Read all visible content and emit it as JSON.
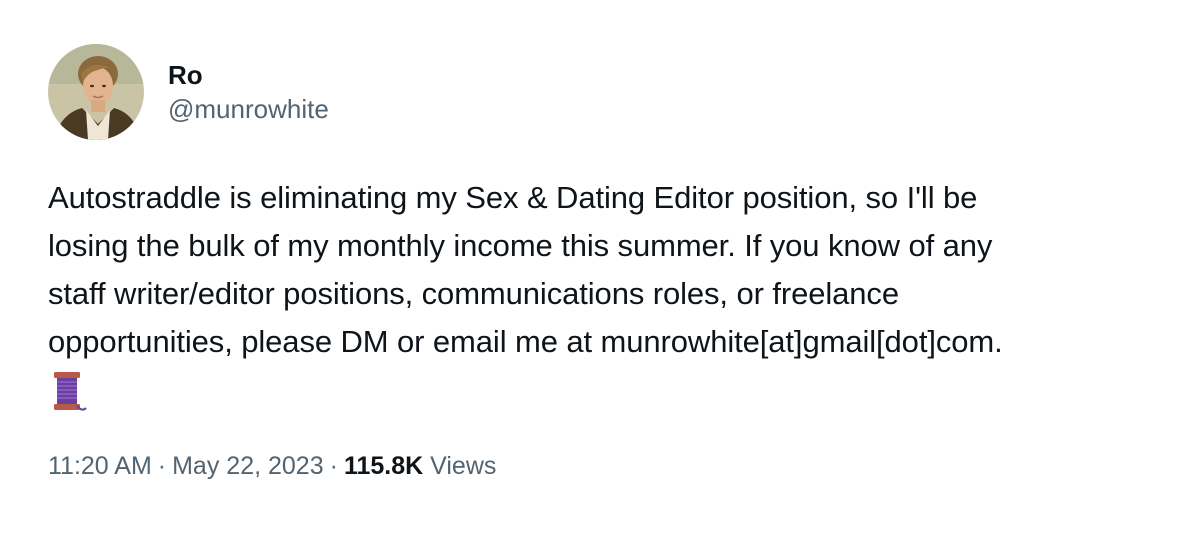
{
  "author": {
    "display_name": "Ro",
    "handle": "@munrowhite"
  },
  "tweet": {
    "lines": [
      "Autostraddle is eliminating my Sex & Dating Editor position, so I'll be",
      "losing the bulk of my monthly income this summer. If you know of any",
      "staff writer/editor positions, communications roles, or freelance",
      "opportunities, please DM or email me at munrowhite[at]gmail[dot]com."
    ],
    "emoji_icon": "thread-spool-icon"
  },
  "meta": {
    "time": "11:20 AM",
    "separator": "·",
    "date": "May 22, 2023",
    "views_count": "115.8K",
    "views_label": "Views"
  },
  "colors": {
    "text_primary": "#0f1419",
    "text_secondary": "#536471",
    "background": "#ffffff"
  }
}
